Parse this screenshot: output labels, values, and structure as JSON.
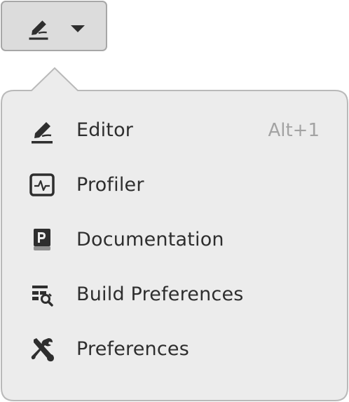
{
  "toolbar": {
    "mode_button_icon": "edit-pen-icon",
    "mode_button_caret": "caret-down-icon"
  },
  "menu": {
    "items": [
      {
        "label": "Editor",
        "accelerator": "Alt+1",
        "icon": "edit-pen-icon"
      },
      {
        "label": "Profiler",
        "accelerator": "",
        "icon": "profiler-graph-icon"
      },
      {
        "label": "Documentation",
        "accelerator": "",
        "icon": "documentation-book-icon"
      },
      {
        "label": "Build Preferences",
        "accelerator": "",
        "icon": "build-preferences-icon"
      },
      {
        "label": "Preferences",
        "accelerator": "",
        "icon": "preferences-tools-icon"
      }
    ]
  },
  "colors": {
    "button_bg": "#dcdcdc",
    "button_border": "#a7a7a7",
    "popover_bg": "#ececec",
    "popover_border": "#b9b9b9",
    "text": "#2e2e2e",
    "accel_text": "#a3a3a3",
    "icon": "#2e2e2e"
  }
}
